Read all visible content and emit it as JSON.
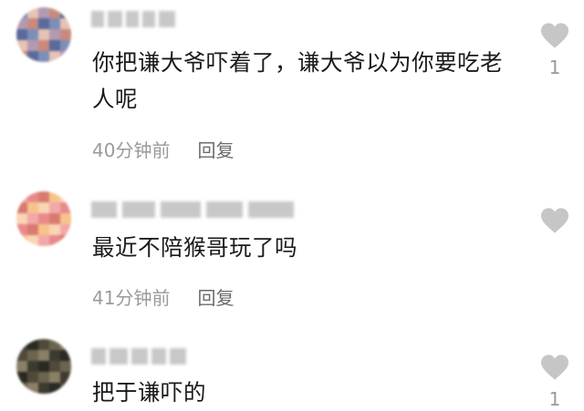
{
  "comments": [
    {
      "text": "你把谦大爷吓着了，谦大爷以为你要吃老人呢",
      "time": "40分钟前",
      "reply_label": "回复",
      "like_count": "1",
      "avatar_colors": [
        "#7d8fb8",
        "#c98a7d",
        "#e6c3b4",
        "#5a6a9a",
        "#b49ab0"
      ]
    },
    {
      "text": "最近不陪猴哥玩了吗",
      "time": "41分钟前",
      "reply_label": "回复",
      "like_count": "",
      "avatar_colors": [
        "#f2a8a8",
        "#f6c48a",
        "#e98a8a",
        "#f8d5b5",
        "#d97a70"
      ]
    },
    {
      "text": "把于谦吓的",
      "time": "",
      "reply_label": "",
      "like_count": "1",
      "avatar_colors": [
        "#3d3a30",
        "#6b6550",
        "#2a2a22",
        "#8a8068",
        "#504a3a"
      ]
    }
  ],
  "colors": {
    "text": "#1a1a1a",
    "meta": "#9a9a9a",
    "reply": "#6b6b6b",
    "heart": "#c6c6c6",
    "username_blur": "#c8c8c8"
  },
  "icons": {
    "like": "heart-icon"
  }
}
